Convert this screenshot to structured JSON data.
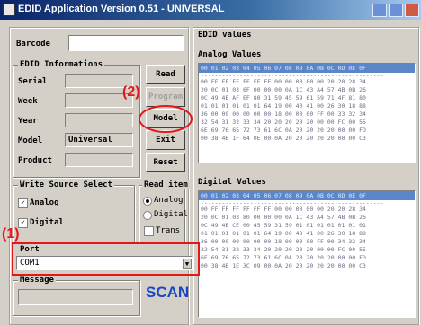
{
  "window": {
    "title": "EDID Application Version 0.51 - UNIVERSAL"
  },
  "barcode": {
    "label": "Barcode",
    "value": ""
  },
  "edid_info": {
    "title": "EDID Informations",
    "serial_label": "Serial",
    "serial_value": "",
    "week_label": "Week",
    "week_value": "",
    "year_label": "Year",
    "year_value": "",
    "model_label": "Model",
    "model_value": "Universal",
    "product_label": "Product",
    "product_value": ""
  },
  "buttons": {
    "read": "Read",
    "program": "Program",
    "model": "Model",
    "exit": "Exit",
    "reset": "Reset"
  },
  "write_source": {
    "title": "Write Source Select",
    "analog": "Analog",
    "digital": "Digital"
  },
  "read_item": {
    "title": "Read item",
    "analog": "Analog",
    "digital": "Digital",
    "trans": "Trans"
  },
  "port": {
    "label": "Port",
    "value": "COM1"
  },
  "message": {
    "label": "Message",
    "value": ""
  },
  "scan": "SCAN",
  "edid_values": {
    "title": "EDID values",
    "analog_title": "Analog Values",
    "analog_header": "00 01 02 03 04 05 06 07 08 09 0A 0B 0C 0D 0E 0F",
    "analog_sep": "----------------------------------------------------",
    "analog_rows": [
      "00 FF FF FF FF FF FF 00 00 00 00 00 20 20 28 34",
      "20 0C 01 03 6F 00 00 00 0A 1C 43 A4 57 4B 0B 26",
      "0C 49 4E AF EF 80 31 59 45 59 61 59 71 4F 81 80",
      "01 01 01 01 01 01 64 19 00 40 41 00 26 30 18 88",
      "36 00 00 00 00 00 00 18 00 00 00 FF 00 33 32 34",
      "32 54 31 32 33 34 20 20 20 20 20 00 00 FC 00 55",
      "6E 69 76 65 72 73 61 6C 0A 20 20 20 20 00 00 FD",
      "00 38 4B 1F 64 0E 00 0A 20 20 20 20 20 00 00 C3"
    ],
    "digital_title": "Digital Values",
    "digital_header": "00 01 02 03 04 05 06 07 08 09 0A 0B 0C 0D 0E 0F",
    "digital_sep": "----------------------------------------------------",
    "digital_rows": [
      "00 FF FF FF FF FF FF 00 00 00 00 00 20 20 28 34",
      "20 0C 01 03 80 00 00 00 0A 1C 43 A4 57 4B 0B 26",
      "0C 49 4E CE 00 45 59 31 59 01 01 01 01 01 01 01",
      "01 01 01 01 01 01 64 19 00 40 41 00 26 30 18 88",
      "36 00 00 00 00 00 00 18 00 00 00 FF 00 34 32 34",
      "32 54 31 32 33 34 20 20 20 20 20 00 00 FC 00 55",
      "6E 69 76 65 72 73 61 6C 0A 20 20 20 20 00 00 FD",
      "00 38 4B 1E 3C 09 00 0A 20 20 20 20 20 00 00 C3"
    ]
  },
  "annotations": {
    "one": "(1)",
    "two": "(2)"
  }
}
